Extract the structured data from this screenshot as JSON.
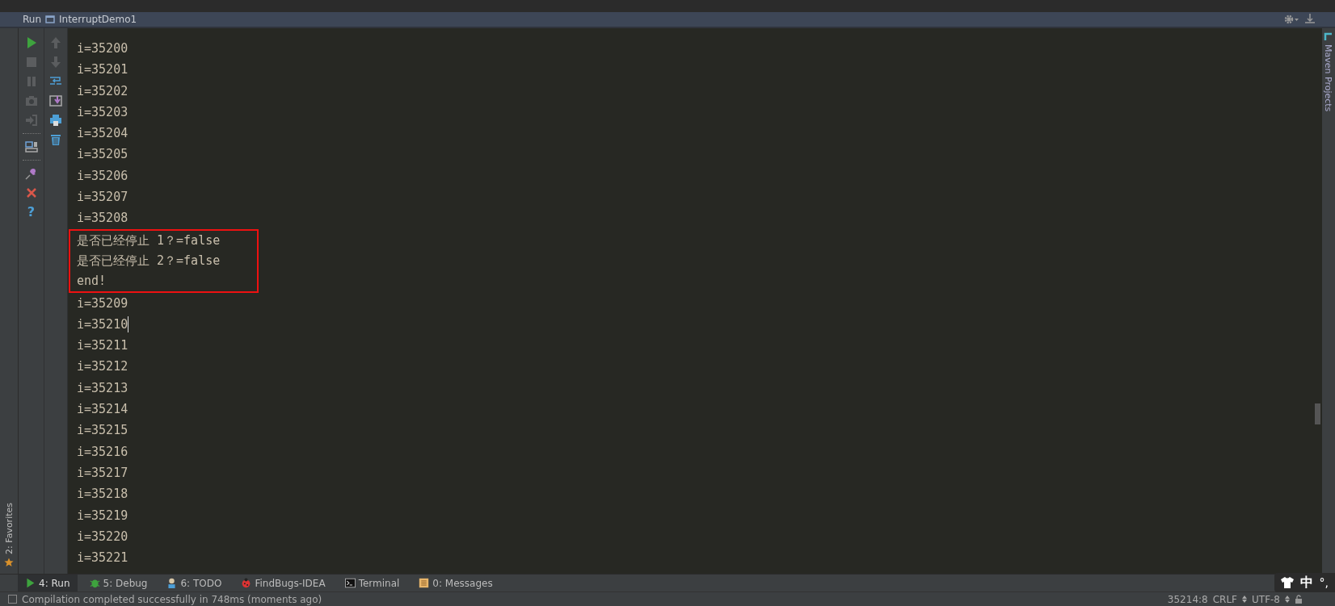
{
  "run_panel": {
    "label": "Run",
    "config": "InterruptDemo1"
  },
  "left_toolbar": {
    "help_glyph": "?"
  },
  "console": {
    "lines": [
      {
        "text": "i=35200",
        "boxed": false,
        "caret": false
      },
      {
        "text": "i=35201",
        "boxed": false,
        "caret": false
      },
      {
        "text": "i=35202",
        "boxed": false,
        "caret": false
      },
      {
        "text": "i=35203",
        "boxed": false,
        "caret": false
      },
      {
        "text": "i=35204",
        "boxed": false,
        "caret": false
      },
      {
        "text": "i=35205",
        "boxed": false,
        "caret": false
      },
      {
        "text": "i=35206",
        "boxed": false,
        "caret": false
      },
      {
        "text": "i=35207",
        "boxed": false,
        "caret": false
      },
      {
        "text": "i=35208",
        "boxed": false,
        "caret": false
      },
      {
        "text": "是否已经停止 1？=false",
        "boxed": true,
        "caret": false
      },
      {
        "text": "是否已经停止 2？=false",
        "boxed": true,
        "caret": false
      },
      {
        "text": "end!",
        "boxed": true,
        "caret": false
      },
      {
        "text": "i=35209",
        "boxed": false,
        "caret": false
      },
      {
        "text": "i=35210",
        "boxed": false,
        "caret": true
      },
      {
        "text": "i=35211",
        "boxed": false,
        "caret": false
      },
      {
        "text": "i=35212",
        "boxed": false,
        "caret": false
      },
      {
        "text": "i=35213",
        "boxed": false,
        "caret": false
      },
      {
        "text": "i=35214",
        "boxed": false,
        "caret": false
      },
      {
        "text": "i=35215",
        "boxed": false,
        "caret": false
      },
      {
        "text": "i=35216",
        "boxed": false,
        "caret": false
      },
      {
        "text": "i=35217",
        "boxed": false,
        "caret": false
      },
      {
        "text": "i=35218",
        "boxed": false,
        "caret": false
      },
      {
        "text": "i=35219",
        "boxed": false,
        "caret": false
      },
      {
        "text": "i=35220",
        "boxed": false,
        "caret": false
      },
      {
        "text": "i=35221",
        "boxed": false,
        "caret": false
      }
    ]
  },
  "side_tabs": {
    "left": "2: Favorites",
    "right": "Maven Projects"
  },
  "tool_tabs": [
    {
      "kind": "run",
      "label": "4: Run",
      "selected": true
    },
    {
      "kind": "debug",
      "label": "5: Debug",
      "selected": false
    },
    {
      "kind": "todo",
      "label": "6: TODO",
      "selected": false
    },
    {
      "kind": "bug",
      "label": "FindBugs-IDEA",
      "selected": false
    },
    {
      "kind": "terminal",
      "label": "Terminal",
      "selected": false
    },
    {
      "kind": "messages",
      "label": "0: Messages",
      "selected": false
    }
  ],
  "ime_bar": {
    "mode": "中",
    "punct": "°,"
  },
  "status_bar": {
    "message": "Compilation completed successfully in 748ms (moments ago)",
    "position": "35214:8",
    "line_separator": "CRLF",
    "encoding": "UTF-8"
  }
}
